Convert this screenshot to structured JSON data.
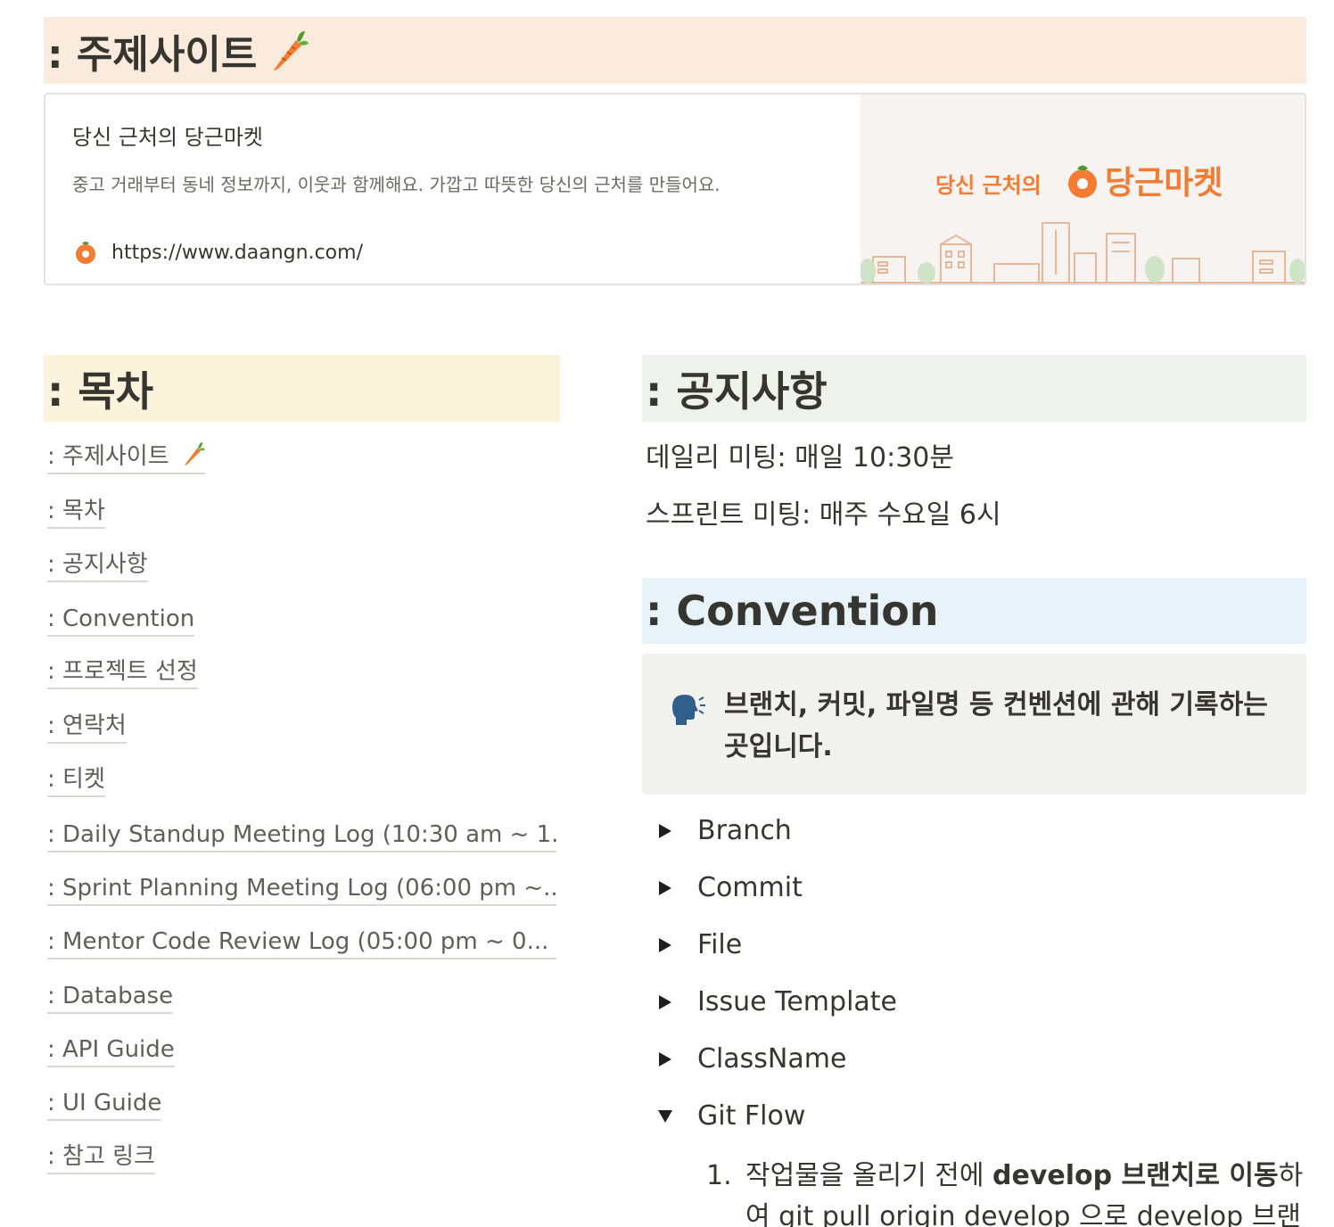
{
  "title": {
    "text": ": 주제사이트",
    "icon": "carrot-icon"
  },
  "bookmark": {
    "title": "당신 근처의 당근마켓",
    "description": "중고 거래부터 동네 정보까지, 이웃과 함께해요. 가깝고 따뜻한 당신의 근처를 만들어요.",
    "url": "https://www.daangn.com/",
    "image_small_text": "당신 근처의",
    "image_logo_text": "당근마켓",
    "brand_color": "#f47b32"
  },
  "toc": {
    "heading": ": 목차",
    "items": [
      ": 주제사이트",
      ": 목차",
      ": 공지사항",
      ": Convention",
      ": 프로젝트 선정",
      ": 연락처",
      ": 티켓",
      ": Daily Standup Meeting Log (10:30 am ~ 1...",
      ": Sprint Planning Meeting Log (06:00 pm ~...",
      ": Mentor Code Review Log (05:00 pm ~ 0...",
      ": Database",
      ": API Guide",
      ": UI Guide",
      ": 참고 링크"
    ]
  },
  "notice": {
    "heading": ": 공지사항",
    "lines": [
      "데일리 미팅: 매일 10:30분",
      "스프린트 미팅: 매주 수요일 6시"
    ]
  },
  "convention": {
    "heading": ": Convention",
    "callout_icon": "speaking-head-icon",
    "callout_text": "브랜치, 커밋, 파일명 등 컨벤션에 관해 기록하는 곳입니다.",
    "toggles": [
      "Branch",
      "Commit",
      "File",
      "Issue Template",
      "ClassName",
      "Git Flow"
    ],
    "gitflow_step": {
      "number": "1.",
      "part1": "작업물을 올리기 전에 ",
      "bold": "develop 브랜치로 이동",
      "part2": "하여 git pull origin develop 으로 develop 브랜치"
    }
  }
}
